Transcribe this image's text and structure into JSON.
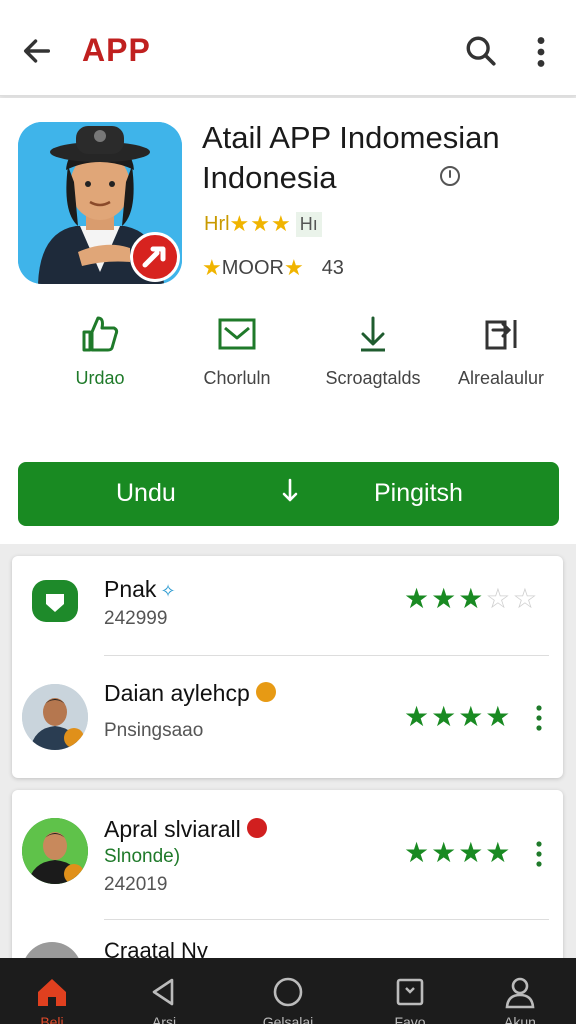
{
  "header": {
    "title": "APP",
    "icons": [
      "back-arrow-icon",
      "search-icon",
      "more-vertical-icon"
    ]
  },
  "app": {
    "name_line1": "Atail APP Indomesian",
    "name_line2": "Indonesia",
    "rating_label": "Hrl",
    "rating_stars": "★★★",
    "rating_suffix": "Hı",
    "rating2_prefix": "★",
    "rating2_text": "MOOR",
    "rating2_suffix": "★",
    "rating2_count": "43"
  },
  "actions": [
    {
      "label": "Urdao",
      "icon": "thumbs-up-icon"
    },
    {
      "label": "Chorluln",
      "icon": "mail-icon"
    },
    {
      "label": "Scroagtalds",
      "icon": "download-icon"
    },
    {
      "label": "Alrealaulur",
      "icon": "share-icon"
    }
  ],
  "install_button": {
    "left_label": "Undu",
    "right_label": "Pingitsh"
  },
  "reviews_card1": [
    {
      "name": "Pnak",
      "sub": "242999",
      "stars": 3,
      "max": 5,
      "badge": "sparkle"
    },
    {
      "name": "Daian aylehcp",
      "sub": "Pnsingsaao",
      "stars": 4,
      "max": 4,
      "badge": "orange"
    }
  ],
  "reviews_card2": [
    {
      "name": "Apral slviarall",
      "sub_green": "Slnonde)",
      "sub": "242019",
      "stars": 4,
      "max": 4,
      "badge": "red"
    }
  ],
  "peek": {
    "name": "Craatal Ny"
  },
  "bottom_nav": [
    {
      "label": "Beli",
      "icon": "home-icon",
      "active": true
    },
    {
      "label": "Arsi",
      "icon": "back-triangle-icon",
      "active": false
    },
    {
      "label": "Gelsalai",
      "icon": "circle-home-icon",
      "active": false
    },
    {
      "label": "Favo",
      "icon": "recent-apps-icon",
      "active": false
    },
    {
      "label": "Akun",
      "icon": "profile-icon",
      "active": false
    }
  ],
  "colors": {
    "brand_red": "#c0201f",
    "primary_green": "#198a22",
    "star_gold": "#f0b400"
  }
}
